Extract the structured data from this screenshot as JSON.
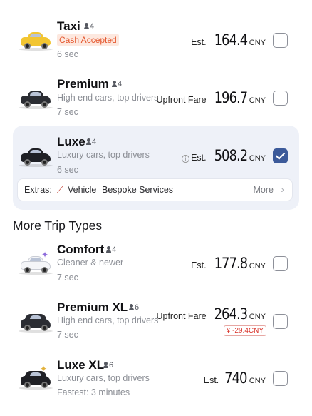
{
  "rides": [
    {
      "name": "Taxi",
      "capacity": "4",
      "badge": "Cash Accepted",
      "time": "6 sec",
      "price_prefix": "Est.",
      "price": "164.4",
      "currency": "CNY",
      "checked": false,
      "car_color": "#f2c531",
      "car_icon": "taxi-car-icon"
    },
    {
      "name": "Premium",
      "capacity": "4",
      "subtitle": "High end cars, top drivers",
      "time": "7 sec",
      "price_prefix": "Upfront Fare",
      "price": "196.7",
      "currency": "CNY",
      "checked": false,
      "car_color": "#2b2d33",
      "car_icon": "sedan-car-icon"
    },
    {
      "name": "Luxe",
      "capacity": "4",
      "subtitle": "Luxury cars, top drivers",
      "time": "6 sec",
      "price_prefix": "Est.",
      "price": "508.2",
      "currency": "CNY",
      "checked": true,
      "car_color": "#1f2025",
      "car_icon": "luxury-car-icon"
    }
  ],
  "extras": {
    "label": "Extras:",
    "vehicle": "Vehicle",
    "service": "Bespoke Services",
    "more": "More"
  },
  "section_title": "More Trip Types",
  "more_rides": [
    {
      "name": "Comfort",
      "capacity": "4",
      "subtitle": "Cleaner & newer",
      "time": "7 sec",
      "price_prefix": "Est.",
      "price": "177.8",
      "currency": "CNY",
      "checked": false,
      "car_color": "#f4f5f8",
      "car_icon": "comfort-car-icon"
    },
    {
      "name": "Premium XL",
      "capacity": "6",
      "subtitle": "High end cars, top drivers",
      "time": "7 sec",
      "price_prefix": "Upfront Fare",
      "price": "264.3",
      "currency": "CNY",
      "discount": "-29.4CNY",
      "checked": false,
      "car_color": "#2b2d33",
      "car_icon": "suv-car-icon"
    },
    {
      "name": "Luxe XL",
      "capacity": "6",
      "subtitle": "Luxury cars, top drivers",
      "time": "Fastest: 3 minutes",
      "price_prefix": "Est.",
      "price": "740",
      "currency": "CNY",
      "checked": false,
      "car_color": "#1f2025",
      "car_icon": "luxury-suv-icon"
    }
  ],
  "colors": {
    "accent": "#3c5a9a",
    "badge_text": "#e4572e",
    "badge_bg": "#fde8df",
    "discount": "#d9342b",
    "selected_bg": "#eef1f8"
  }
}
